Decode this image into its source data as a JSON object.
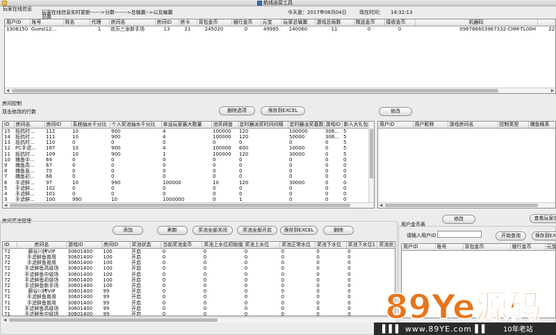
{
  "window": {
    "title": "航线运营工具"
  },
  "online": {
    "group_title": "玩家在线信息",
    "marquee_line1": "玩家在线信息实时更新------>分数------->总输赢-->以及输赢",
    "marquee_line2": "总赢",
    "today_label": "今天是：",
    "today_value": "2017年08月04日",
    "time_label": "现在时间：",
    "time_value": "14:32:13",
    "columns": [
      "用户ID",
      "账号",
      "姓名",
      "代理",
      "房间名",
      "房间ID",
      "房卡",
      "背包金币",
      "银行金币",
      "元宝",
      "玩家总输赢",
      "游戏总局数",
      "赠送金币",
      "接收金币",
      "机器码",
      ""
    ],
    "rows": [
      [
        "1308150",
        "Guest12...",
        "",
        "1",
        "欢乐三张新手场",
        "13",
        "21",
        "245020",
        "0",
        "49995",
        "140060",
        "11",
        "0",
        "0",
        "098786603967332-CHM-TL00H",
        "221."
      ]
    ]
  },
  "room": {
    "group_title": "房间控制",
    "hint": "双击修改的行数",
    "delete_button": "删除选项",
    "save_button": "保存到EXCEL",
    "modify_button": "修改",
    "columns": [
      "ID",
      "房间名",
      "房间ID",
      "系统抽水千分比",
      "个人奖池抽水千分比",
      "幸运玩家最大数量",
      "池奖阀值",
      "定时器派奖时间间隔",
      "定时器派奖基数",
      "游戏ID",
      "新人大礼包限"
    ],
    "rows": [
      [
        "15",
        "抵抗时...",
        "112",
        "10",
        "900",
        "4",
        "100000",
        "120",
        "100000",
        "306...",
        "5"
      ],
      [
        "14",
        "抵抗时...",
        "111",
        "10",
        "900",
        "4",
        "100000",
        "120",
        "50000",
        "306...",
        "5"
      ],
      [
        "13",
        "抵抗时...",
        "110",
        "0",
        "0",
        "0",
        "0",
        "0",
        "0",
        "0",
        "5"
      ],
      [
        "12",
        "PC手滤...",
        "187",
        "10",
        "900",
        "4",
        "100000",
        "600",
        "10000",
        "0",
        "5"
      ],
      [
        "11",
        "抵抗时...",
        "109",
        "10",
        "900",
        "1",
        "100000",
        "120",
        "30000",
        "0",
        "5"
      ],
      [
        "10",
        "捕鱼中...",
        "69",
        "0",
        "0",
        "0",
        "0",
        "0",
        "0",
        "0",
        "0"
      ],
      [
        "9",
        "捕鱼高...",
        "67",
        "0",
        "0",
        "0",
        "0",
        "0",
        "0",
        "0",
        "0"
      ],
      [
        "8",
        "捕鱼急...",
        "70",
        "0",
        "0",
        "0",
        "0",
        "0",
        "0",
        "0",
        "0"
      ],
      [
        "7",
        "捕鱼初...",
        "68",
        "0",
        "0",
        "0",
        "0",
        "0",
        "0",
        "0",
        "0"
      ],
      [
        "6",
        "手滤鲜...",
        "97",
        "10",
        "990",
        "100000",
        "10",
        "120",
        "30000",
        "0",
        "0"
      ],
      [
        "5",
        "手滤鲜...",
        "102",
        "0",
        "0",
        "0",
        "0",
        "0",
        "0",
        "0",
        "0"
      ],
      [
        "4",
        "手滤鲜...",
        "101",
        "0",
        "0",
        "0",
        "0",
        "0",
        "0",
        "0",
        "0"
      ],
      [
        "3",
        "手滤鲜...",
        "100",
        "990",
        "10",
        "1000000",
        "0",
        "1",
        "0",
        "0",
        "0"
      ]
    ]
  },
  "user_ctrl": {
    "columns": [
      "用户ID",
      "用户昵称",
      "游戏房间名",
      "控制类型",
      "捕鱼概率"
    ]
  },
  "prize": {
    "group_title": "房间奖池管理",
    "buttons": [
      "添加",
      "刷新",
      "奖池全部关闭",
      "奖池全部开启",
      "保存到EXCEL",
      "删除"
    ],
    "modify_button": "修改",
    "columns": [
      "ID",
      "房间名",
      "游戏ID",
      "房间ID",
      "奖池状态",
      "当前奖池金币",
      "奖池上水位初始值",
      "奖池上水位",
      "奖池正常水位",
      "奖池下水位",
      "奖池下水位1",
      "奖池状"
    ],
    "rows": [
      [
        "72",
        "廊谷川拷VIP",
        "30601400",
        "100",
        "开启",
        "0",
        "0",
        "0",
        "0",
        "0",
        "0"
      ],
      [
        "72",
        "手滤鲜鱼普用",
        "30601400",
        "100",
        "开启",
        "0",
        "0",
        "0",
        "0",
        "0",
        "0"
      ],
      [
        "72",
        "手滤鲜鱼普用",
        "30601400",
        "100",
        "开启",
        "0",
        "0",
        "0",
        "0",
        "0",
        "0"
      ],
      [
        "72",
        "手滤鲜鱼高级场",
        "30601400",
        "100",
        "开启",
        "0",
        "0",
        "0",
        "0",
        "0",
        "0"
      ],
      [
        "72",
        "手滤鲜鱼中级场",
        "30601400",
        "100",
        "开启",
        "0",
        "0",
        "0",
        "0",
        "0",
        "0"
      ],
      [
        "72",
        "手滤鲜鱼初级场",
        "30601400",
        "100",
        "开启",
        "0",
        "0",
        "0",
        "0",
        "0",
        "0"
      ],
      [
        "72",
        "手滤鲜鱼新手场",
        "30601400",
        "100",
        "开启",
        "0",
        "0",
        "0",
        "0",
        "0",
        "0"
      ],
      [
        "71",
        "廊谷川拷VIP",
        "30601400",
        "99",
        "开启",
        "0",
        "0",
        "0",
        "0",
        "0",
        "0"
      ],
      [
        "71",
        "手滤鲜鱼普用",
        "30601400",
        "99",
        "开启",
        "0",
        "0",
        "0",
        "0",
        "0",
        "0"
      ],
      [
        "71",
        "手滤鲜鱼普用",
        "30601400",
        "99",
        "开启",
        "0",
        "0",
        "0",
        "0",
        "0",
        "0"
      ],
      [
        "71",
        "手滤鲜鱼高级场",
        "30601400",
        "99",
        "开启",
        "0",
        "0",
        "0",
        "0",
        "0",
        "0"
      ],
      [
        "71",
        "手滤鲜鱼中级场",
        "30601400",
        "99",
        "开启",
        "0",
        "0",
        "0",
        "0",
        "0",
        "0"
      ]
    ]
  },
  "user_money": {
    "group_title": "用户金币表",
    "view_button": "查看玩家信",
    "input_label": "请输入用户ID",
    "input_value": "",
    "query_button": "开始查询",
    "save_button": "保存到EXC",
    "columns": [
      "用户ID",
      "账号",
      "背包金币",
      "银行金币",
      "元宝"
    ]
  },
  "watermark": {
    "brand": "89Ye源码",
    "url": "www.89YE.com",
    "tag": "10年老站"
  },
  "colors": {
    "accent": "#e8741a",
    "selection": "#cfd8e8"
  }
}
